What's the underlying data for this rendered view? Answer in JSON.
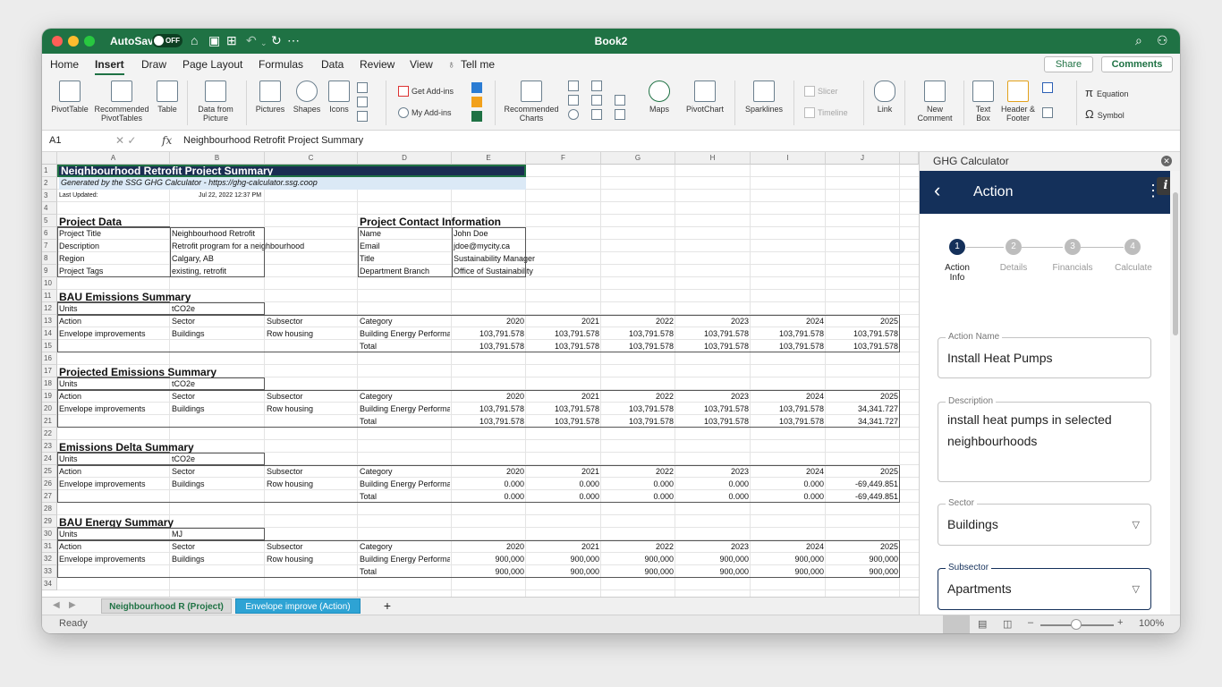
{
  "titlebar": {
    "autosave": "AutoSave",
    "toggle": "OFF",
    "doc_title": "Book2"
  },
  "ribbon_tabs": [
    "Home",
    "Insert",
    "Draw",
    "Page Layout",
    "Formulas",
    "Data",
    "Review",
    "View",
    "Tell me"
  ],
  "share": "Share",
  "comments": "Comments",
  "ribbon": {
    "pivot_table": "PivotTable",
    "recommended_pivot": "Recommended PivotTables",
    "table": "Table",
    "data_from_picture": "Data from Picture",
    "pictures": "Pictures",
    "shapes": "Shapes",
    "icons": "Icons",
    "get_addins": "Get Add-ins",
    "my_addins": "My Add-ins",
    "recommended_charts": "Recommended Charts",
    "maps": "Maps",
    "pivot_chart": "PivotChart",
    "sparklines": "Sparklines",
    "slicer": "Slicer",
    "timeline": "Timeline",
    "link": "Link",
    "new_comment": "New Comment",
    "text_box": "Text Box",
    "header_footer": "Header & Footer",
    "equation": "Equation",
    "symbol": "Symbol"
  },
  "formula_bar": {
    "name_box": "A1",
    "fx": "fx",
    "content": "Neighbourhood Retrofit Project Summary"
  },
  "columns": [
    "A",
    "B",
    "C",
    "D",
    "E",
    "F",
    "G",
    "H",
    "I",
    "J"
  ],
  "rows": [
    "1",
    "2",
    "3",
    "4",
    "5",
    "6",
    "7",
    "8",
    "9",
    "10",
    "11",
    "12",
    "13",
    "14",
    "15",
    "16",
    "17",
    "18",
    "19",
    "20",
    "21",
    "22",
    "23",
    "24",
    "25",
    "26",
    "27",
    "28",
    "29",
    "30",
    "31",
    "32",
    "33",
    "34"
  ],
  "sheet": {
    "title": "Neighbourhood Retrofit Project Summary",
    "generated": "Generated by the SSG GHG Calculator - https://ghg-calculator.ssg.coop",
    "last_updated_label": "Last Updated:",
    "last_updated_value": "Jul 22, 2022 12:37 PM",
    "project_data": "Project Data",
    "project_title_label": "Project Title",
    "project_title": "Neighbourhood Retrofit",
    "description_label": "Description",
    "description": "Retrofit program for a neighbourhood",
    "region_label": "Region",
    "region": "Calgary, AB",
    "tags_label": "Project Tags",
    "tags": "existing, retrofit",
    "contact": "Project Contact Information",
    "name_label": "Name",
    "name": "John Doe",
    "email_label": "Email",
    "email": "jdoe@mycity.ca",
    "title_label": "Title",
    "title_value": "Sustainability Manager",
    "dept_label": "Department Branch",
    "dept": "Office of Sustainability",
    "units": "Units",
    "tco2e": "tCO2e",
    "mj": "MJ",
    "action": "Action",
    "sector": "Sector",
    "subsector": "Subsector",
    "category": "Category",
    "envelope": "Envelope improvements",
    "buildings": "Buildings",
    "row_housing": "Row housing",
    "bep": "Building Energy Performa",
    "total": "Total",
    "years": [
      "2020",
      "2021",
      "2022",
      "2023",
      "2024",
      "2025"
    ],
    "sections": [
      {
        "title": "BAU Emissions Summary",
        "row_vals": [
          "103,791.578",
          "103,791.578",
          "103,791.578",
          "103,791.578",
          "103,791.578",
          "103,791.578"
        ],
        "total_vals": [
          "103,791.578",
          "103,791.578",
          "103,791.578",
          "103,791.578",
          "103,791.578",
          "103,791.578"
        ]
      },
      {
        "title": "Projected Emissions Summary",
        "row_vals": [
          "103,791.578",
          "103,791.578",
          "103,791.578",
          "103,791.578",
          "103,791.578",
          "34,341.727"
        ],
        "total_vals": [
          "103,791.578",
          "103,791.578",
          "103,791.578",
          "103,791.578",
          "103,791.578",
          "34,341.727"
        ]
      },
      {
        "title": "Emissions Delta Summary",
        "row_vals": [
          "0.000",
          "0.000",
          "0.000",
          "0.000",
          "0.000",
          "-69,449.851"
        ],
        "total_vals": [
          "0.000",
          "0.000",
          "0.000",
          "0.000",
          "0.000",
          "-69,449.851"
        ]
      },
      {
        "title": "BAU Energy Summary",
        "row_vals": [
          "900,000",
          "900,000",
          "900,000",
          "900,000",
          "900,000",
          "900,000"
        ],
        "total_vals": [
          "900,000",
          "900,000",
          "900,000",
          "900,000",
          "900,000",
          "900,000"
        ]
      }
    ]
  },
  "sheet_tabs": [
    "Neighbourhood R (Project)",
    "Envelope improve (Action)",
    "+"
  ],
  "status": {
    "ready": "Ready",
    "zoom": "100%"
  },
  "pane": {
    "title": "GHG Calculator",
    "app_title": "Action",
    "steps": [
      {
        "num": "1",
        "label": "Action Info"
      },
      {
        "num": "2",
        "label": "Details"
      },
      {
        "num": "3",
        "label": "Financials"
      },
      {
        "num": "4",
        "label": "Calculate"
      }
    ],
    "fields": {
      "action_name_label": "Action Name",
      "action_name": "Install Heat Pumps",
      "description_label": "Description",
      "description_line1": "install heat pumps in selected",
      "description_line2": "neighbourhoods",
      "sector_label": "Sector",
      "sector": "Buildings",
      "subsector_label": "Subsector",
      "subsector": "Apartments"
    }
  },
  "colors": {
    "excel_green": "#1f7244",
    "navy": "#14305a",
    "active_tab": "#2ea3d4"
  }
}
